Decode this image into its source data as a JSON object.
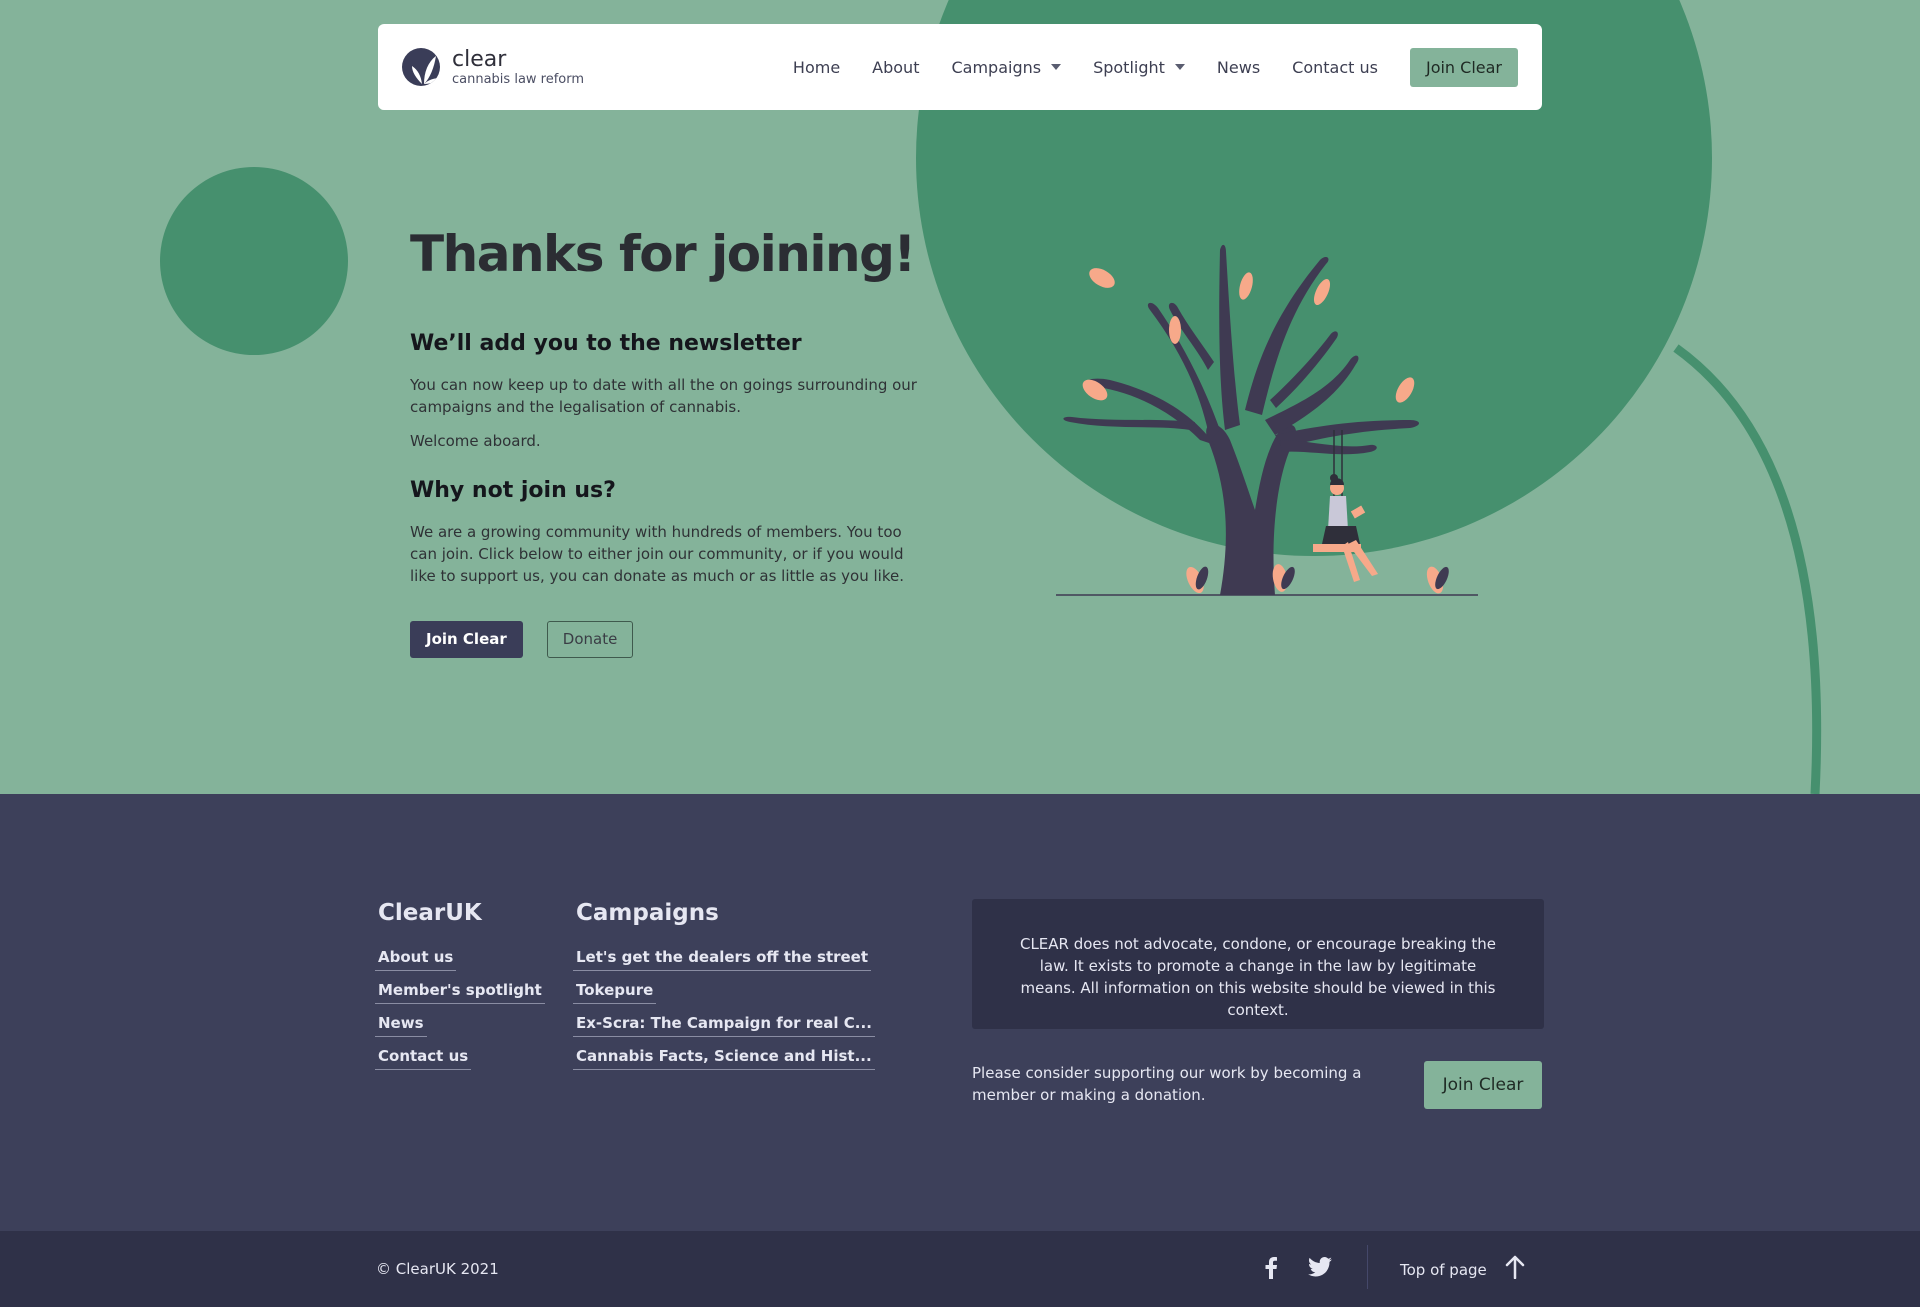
{
  "brand": {
    "name": "clear",
    "tagline": "cannabis law reform"
  },
  "nav": {
    "items": [
      {
        "label": "Home"
      },
      {
        "label": "About"
      },
      {
        "label": "Campaigns"
      },
      {
        "label": "Spotlight"
      },
      {
        "label": "News"
      },
      {
        "label": "Contact us"
      }
    ],
    "join_label": "Join Clear"
  },
  "hero": {
    "title": "Thanks for joining!",
    "newsletter_heading": "We’ll add you to the newsletter",
    "newsletter_text": "You can now keep up to date with all the on goings surrounding our campaigns and the legalisation of cannabis.",
    "welcome_text": "Welcome aboard.",
    "join_heading": "Why not join us?",
    "join_text": "We are a growing community with hundreds of members. You too can join. Click below to either join our community, or if you would like to support us, you can donate as much or as little as you like.",
    "join_button": "Join Clear",
    "donate_button": "Donate"
  },
  "footer": {
    "clearuk": {
      "title": "ClearUK",
      "links": [
        "About us",
        "Member's spotlight",
        "News",
        "Contact us"
      ]
    },
    "campaigns": {
      "title": "Campaigns",
      "links": [
        "Let's get the dealers off the street",
        "Tokepure",
        "Ex-Scra: The Campaign for real C...",
        "Cannabis Facts, Science and Hist..."
      ]
    },
    "disclaimer": "CLEAR does not advocate, condone, or encourage breaking the law. It exists to promote a change in the law by legitimate means. All information on this website should be viewed in this context.",
    "support_text": "Please consider supporting our work by becoming a member or making a donation.",
    "join_button": "Join Clear"
  },
  "bottom": {
    "copyright": "© ClearUK 2021",
    "top_of_page": "Top of page",
    "icons": [
      "facebook-icon",
      "twitter-icon",
      "arrow-up-icon"
    ]
  },
  "colors": {
    "hero_bg": "#84b39a",
    "accent_green": "#46906e",
    "footer_bg": "#3d405a",
    "bottom_bg": "#2f3148",
    "dark_button": "#3a3d58",
    "leaf": "#f7a98a"
  }
}
